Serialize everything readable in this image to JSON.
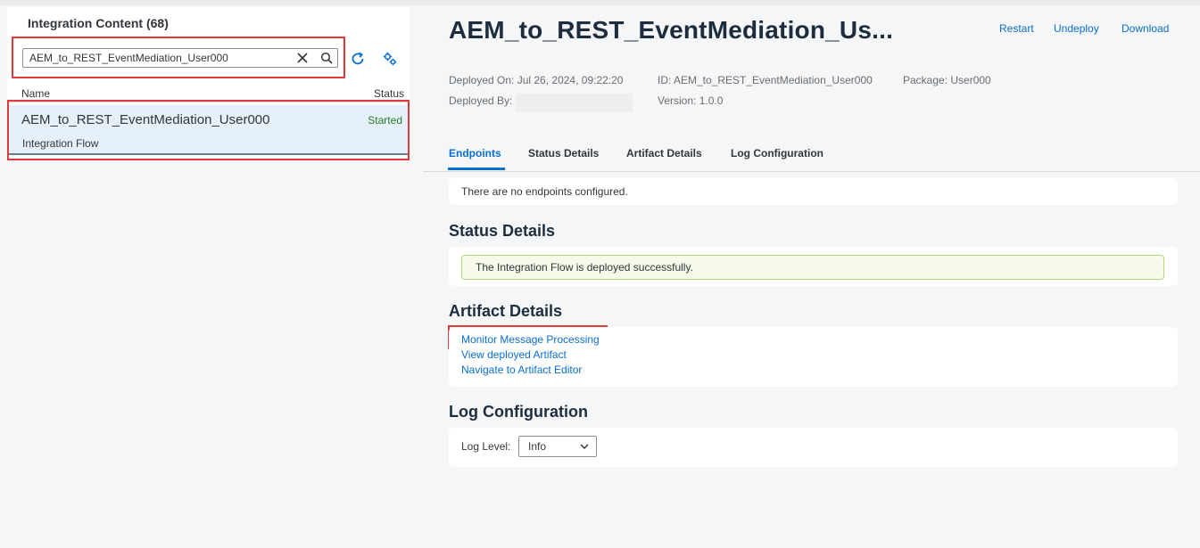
{
  "left_panel": {
    "title": "Integration Content (68)",
    "search": {
      "value": "AEM_to_REST_EventMediation_User000",
      "icons": [
        "close-icon",
        "search-icon"
      ]
    },
    "toolbar_icons": [
      "refresh-icon",
      "settings-icon"
    ],
    "columns": {
      "name": "Name",
      "status": "Status"
    },
    "rows": [
      {
        "name": "AEM_to_REST_EventMediation_User000",
        "type": "Integration Flow",
        "status": "Started"
      }
    ]
  },
  "header": {
    "title": "AEM_to_REST_EventMediation_Us...",
    "actions": [
      "Restart",
      "Undeploy",
      "Download"
    ],
    "meta": {
      "deployed_on": "Deployed On: Jul 26, 2024, 09:22:20",
      "deployed_by": "Deployed By:",
      "id": "ID: AEM_to_REST_EventMediation_User000",
      "version": "Version: 1.0.0",
      "package": "Package: User000"
    }
  },
  "tabs": [
    "Endpoints",
    "Status Details",
    "Artifact Details",
    "Log Configuration"
  ],
  "active_tab": "Endpoints",
  "endpoints": {
    "message": "There are no endpoints configured."
  },
  "status_details": {
    "title": "Status Details",
    "message": "The Integration Flow is deployed successfully."
  },
  "artifact_details": {
    "title": "Artifact Details",
    "links": [
      "Monitor Message Processing",
      "View deployed Artifact",
      "Navigate to Artifact Editor"
    ]
  },
  "log_configuration": {
    "title": "Log Configuration",
    "label": "Log Level:",
    "value": "Info"
  },
  "colors": {
    "accent": "#0a6ed1",
    "highlight": "#e03a3a",
    "success_text": "#2b7d2b"
  }
}
